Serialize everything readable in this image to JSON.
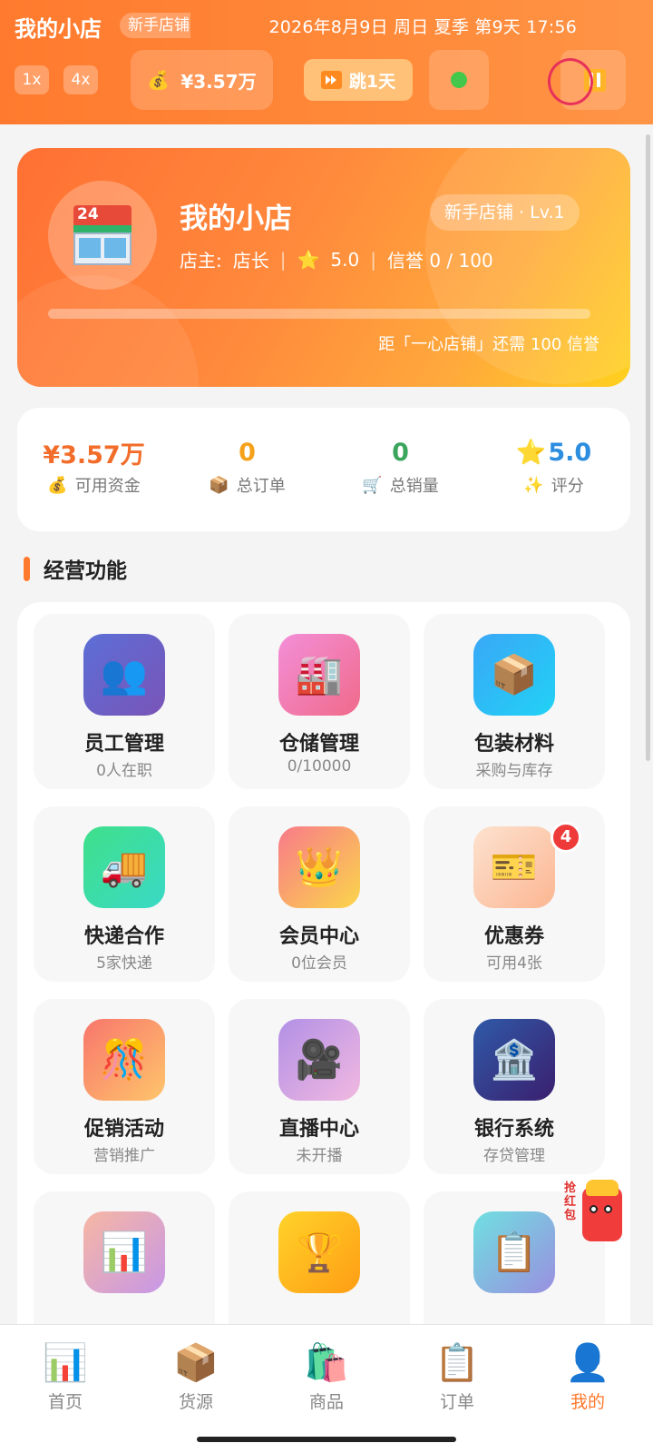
{
  "header": {
    "title": "我的小店",
    "badge": "新手店铺",
    "datetime": "2026年8月9日 周日 夏季 第9天 17:56",
    "speed_options": [
      "1x",
      "4x"
    ],
    "money": "¥3.57万",
    "money_icon": "money-bag",
    "skip_label": "跳1天",
    "status_color": "#43c84b",
    "pause_icon": "pause-icon"
  },
  "shop": {
    "name": "我的小店",
    "level": "新手店铺 · Lv.1",
    "owner_label": "店主:",
    "owner": "店长",
    "rating": "5.0",
    "credit": "信誉 0 / 100",
    "progress_fraction": 0.0,
    "progress_text": "距「一心店铺」还需 100 信誉",
    "store_icon_text": "24"
  },
  "stats": [
    {
      "value": "¥3.57万",
      "label": "可用资金",
      "icon": "💰",
      "color": "#f26c2a"
    },
    {
      "value": "0",
      "label": "总订单",
      "icon": "📦",
      "color": "#f5a21a"
    },
    {
      "value": "0",
      "label": "总销量",
      "icon": "🛒",
      "color": "#3aa55b"
    },
    {
      "value": "5.0",
      "prefix_icon": "⭐",
      "label": "评分",
      "icon": "✨",
      "color": "#2d8ee0"
    }
  ],
  "section": {
    "title": "经营功能"
  },
  "features": [
    {
      "name": "员工管理",
      "sub": "0人在职",
      "icon": "👥",
      "bg": "linear-gradient(135deg,#5b6fd6,#7a54b8)"
    },
    {
      "name": "仓储管理",
      "sub": "0/10000",
      "icon": "🏭",
      "bg": "linear-gradient(135deg,#f38fd8,#f06a8a)"
    },
    {
      "name": "包装材料",
      "sub": "采购与库存",
      "icon": "📦",
      "bg": "linear-gradient(135deg,#3aa7f7,#21d2f5)"
    },
    {
      "name": "快递合作",
      "sub": "5家快递",
      "icon": "🚚",
      "bg": "linear-gradient(135deg,#3fe08a,#3ad9c6)"
    },
    {
      "name": "会员中心",
      "sub": "0位会员",
      "icon": "👑",
      "bg": "linear-gradient(135deg,#f87a8a,#fbd64a)"
    },
    {
      "name": "优惠券",
      "sub": "可用4张",
      "icon": "🎫",
      "bg": "linear-gradient(135deg,#fde2cf,#fbb692)",
      "badge": "4"
    },
    {
      "name": "促销活动",
      "sub": "营销推广",
      "icon": "🎊",
      "bg": "linear-gradient(135deg,#f8766c,#fec56b)"
    },
    {
      "name": "直播中心",
      "sub": "未开播",
      "icon": "🎥",
      "bg": "linear-gradient(135deg,#b290e6,#f1b9e0)"
    },
    {
      "name": "银行系统",
      "sub": "存贷管理",
      "icon": "🏦",
      "bg": "linear-gradient(135deg,#2f5aa8,#3a1f6e)"
    },
    {
      "name": "",
      "sub": "",
      "icon": "📊",
      "bg": "linear-gradient(135deg,#f7b7a3,#c797e6)"
    },
    {
      "name": "",
      "sub": "",
      "icon": "🏆",
      "bg": "linear-gradient(135deg,#ffd32a,#ff9d14)"
    },
    {
      "name": "",
      "sub": "",
      "icon": "📋",
      "bg": "linear-gradient(135deg,#6fe0e0,#9a8fe0)"
    }
  ],
  "floating": {
    "text": "抢红包",
    "icon": "red-packet-mascot"
  },
  "bottom_nav": [
    {
      "label": "首页",
      "icon": "📊",
      "active": false
    },
    {
      "label": "货源",
      "icon": "📦",
      "active": false
    },
    {
      "label": "商品",
      "icon": "🛍️",
      "active": false
    },
    {
      "label": "订单",
      "icon": "📋",
      "active": false
    },
    {
      "label": "我的",
      "icon": "👤",
      "active": true
    }
  ]
}
